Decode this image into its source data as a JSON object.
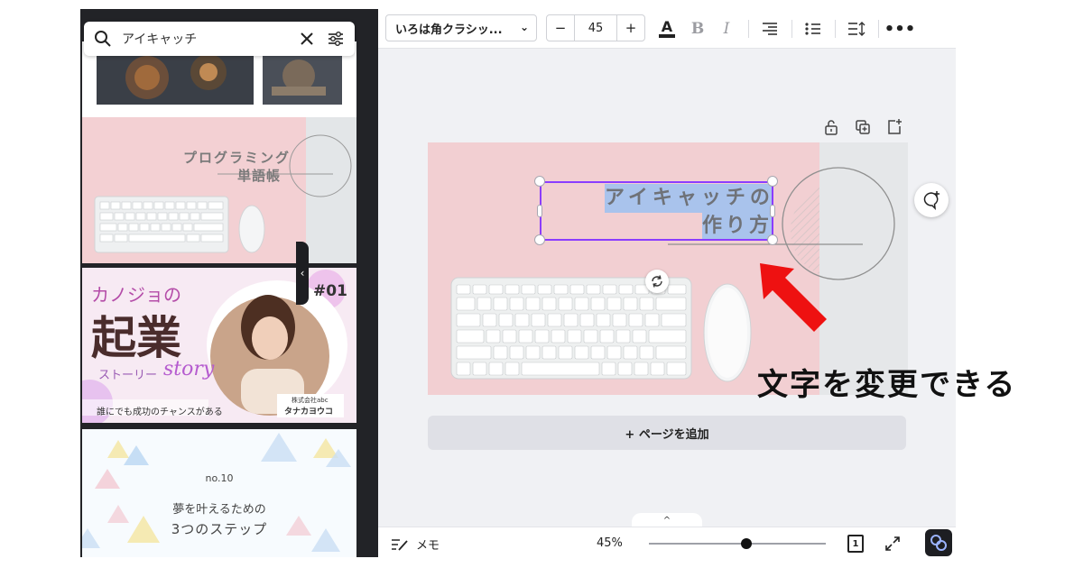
{
  "search": {
    "query": "アイキャッチ"
  },
  "templates": {
    "t2": {
      "title_line1": "プログラミング",
      "title_line2": "単語帳"
    },
    "t3": {
      "line1": "カノジョの",
      "big": "起業",
      "sub": "ストーリー",
      "script": "story",
      "badge": "#01",
      "footer": "誰にでも成功のチャンスがある",
      "company": "株式会社abc",
      "name": "タナカヨウコ"
    },
    "t4": {
      "no": "no.10",
      "line1": "夢を叶えるための",
      "line2": "3つのステップ"
    }
  },
  "toolbar": {
    "font_name": "いろは角クラシッ...",
    "font_size": "45",
    "minus": "−",
    "plus": "+"
  },
  "design": {
    "text_line1": "アイキャッチの",
    "text_line2": "作り方"
  },
  "add_page_label": "+ ページを追加",
  "annotation": "文字を変更できる",
  "bottom": {
    "memo": "メモ",
    "zoom": "45%",
    "zoom_fraction": 0.45,
    "page_number": "1"
  },
  "colors": {
    "selection": "#8b3dff",
    "text_highlight": "#a9c3ec",
    "arrow": "#ee1111",
    "design_bg": "#f2cfd2"
  }
}
